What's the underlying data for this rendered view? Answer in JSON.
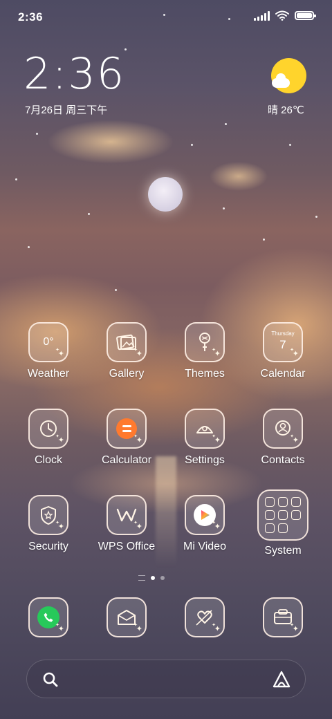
{
  "status_bar": {
    "time": "2:36",
    "signal_icon": "signal-icon",
    "wifi_icon": "wifi-icon",
    "battery_icon": "battery-icon",
    "battery_level": 1.0
  },
  "clock_widget": {
    "time": "2:36",
    "date": "7月26日 周三下午"
  },
  "weather_widget": {
    "icon": "partly-sunny-icon",
    "text": "晴 26℃"
  },
  "apps": [
    {
      "label": "Weather",
      "icon": "weather-icon",
      "icon_text": "0°"
    },
    {
      "label": "Gallery",
      "icon": "gallery-icon"
    },
    {
      "label": "Themes",
      "icon": "themes-icon"
    },
    {
      "label": "Calendar",
      "icon": "calendar-icon",
      "icon_day": "Thursday",
      "icon_date": "7"
    },
    {
      "label": "Clock",
      "icon": "clock-icon"
    },
    {
      "label": "Calculator",
      "icon": "calculator-icon"
    },
    {
      "label": "Settings",
      "icon": "settings-icon"
    },
    {
      "label": "Contacts",
      "icon": "contacts-icon"
    },
    {
      "label": "Security",
      "icon": "security-icon"
    },
    {
      "label": "WPS Office",
      "icon": "wps-office-icon"
    },
    {
      "label": "Mi Video",
      "icon": "mi-video-icon"
    },
    {
      "label": "System",
      "icon": "system-folder-icon"
    }
  ],
  "page_indicator": {
    "pages": 2,
    "current": 1
  },
  "dock": [
    {
      "icon": "phone-icon"
    },
    {
      "icon": "messages-icon"
    },
    {
      "icon": "heart-arrow-icon"
    },
    {
      "icon": "browser-icon"
    }
  ],
  "search_bar": {
    "search_icon": "search-icon",
    "assistant_icon": "app-vault-icon"
  },
  "colors": {
    "weather_sun": "#ffd42c",
    "calculator_orange": "#ff7a2e",
    "phone_green": "#27c95a",
    "icon_outline": "#fff0e6"
  }
}
